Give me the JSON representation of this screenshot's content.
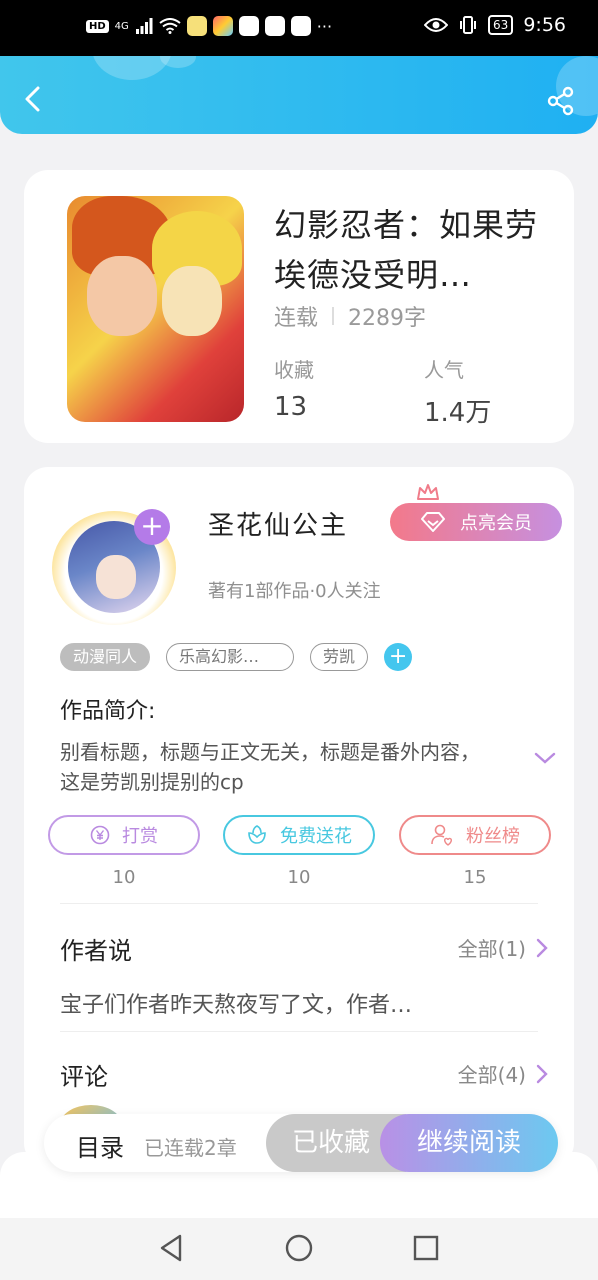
{
  "status_bar": {
    "hd": "HD",
    "network": "4G",
    "more": "···",
    "battery": "63",
    "time": "9:56"
  },
  "header": {
    "back_icon": "back-arrow-icon",
    "share_icon": "share-icon"
  },
  "book": {
    "title": "幻影忍者：如果劳埃德没受明…",
    "status": "连载",
    "word_count": "2289字",
    "stats": [
      {
        "label": "收藏",
        "value": "13"
      },
      {
        "label": "人气",
        "value": "1.4万"
      }
    ]
  },
  "author": {
    "name": "圣花仙公主",
    "vip_label": "点亮会员",
    "sub": "著有1部作品·0人关注",
    "follow_icon": "plus-icon"
  },
  "tags": [
    "动漫同人",
    "乐高幻影…",
    "劳凯"
  ],
  "intro": {
    "title": "作品简介:",
    "text": "别看标题，标题与正文无关，标题是番外内容，这是劳凯别提别的cp"
  },
  "actions": [
    {
      "label": "打赏",
      "count": "10",
      "icon": "yen-icon",
      "color": "#b98ae0"
    },
    {
      "label": "免费送花",
      "count": "10",
      "icon": "flower-icon",
      "color": "#48c8e0"
    },
    {
      "label": "粉丝榜",
      "count": "15",
      "icon": "fan-icon",
      "color": "#ef8a8a"
    }
  ],
  "author_says": {
    "title": "作者说",
    "link": "全部(1)",
    "text": "宝子们作者昨天熬夜写了文，作者…"
  },
  "comments": {
    "title": "评论",
    "link": "全部(4)"
  },
  "bottom_bar": {
    "toc": "目录",
    "toc_sub": "已连载2章",
    "favorited": "已收藏",
    "continue": "继续阅读"
  },
  "colors": {
    "header": "#2bb8f0",
    "accent_purple": "#b47be8",
    "vip_gradient_start": "#f3798a",
    "chevron": "#b98ae0"
  }
}
